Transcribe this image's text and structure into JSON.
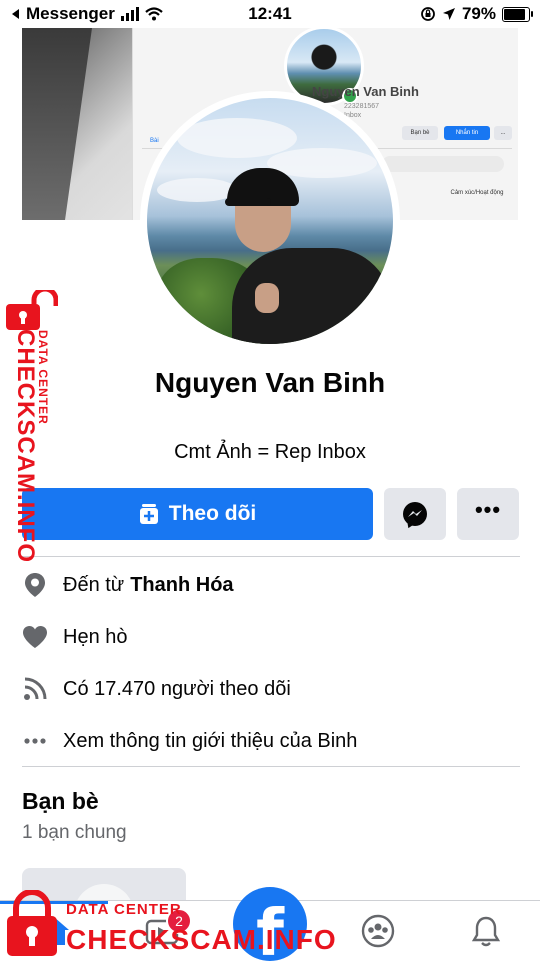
{
  "status_bar": {
    "back_app": "Messenger",
    "time": "12:41",
    "battery": "79%",
    "battery_level": 0.79
  },
  "cover_photo": {
    "name": "Nguyen Van Binh",
    "sub1": "223281567",
    "sub2": "Inbox",
    "btn_friends": "Bạn bè",
    "btn_message": "Nhắn tin",
    "btn_more": "...",
    "tab": "Bài",
    "post_hint": "Cảm xúc/Hoạt động",
    "status_dot_color": "#31a24c"
  },
  "profile": {
    "name": "Nguyen Van Binh",
    "bio": "Cmt Ảnh = Rep Inbox"
  },
  "actions": {
    "follow_label": "Theo dõi",
    "messenger_icon": "messenger-icon",
    "more_label": "•••",
    "accent": "#1877f2"
  },
  "intro": [
    {
      "icon": "location-pin-icon",
      "prefix": "Đến từ",
      "value": "Thanh Hóa"
    },
    {
      "icon": "heart-icon",
      "prefix": "Hẹn hò",
      "value": ""
    },
    {
      "icon": "rss-feed-icon",
      "prefix": "Có 17.470 người theo dõi",
      "value": ""
    },
    {
      "icon": "ellipsis-icon",
      "prefix": "Xem thông tin giới thiệu của Binh",
      "value": ""
    }
  ],
  "friends": {
    "title": "Bạn bè",
    "subtitle": "1 bạn chung"
  },
  "bottom_nav": {
    "video_badge": "2",
    "logo_letter": "f"
  },
  "watermark": {
    "small": "DATA CENTER",
    "big": "CHECKSCAM.INFO"
  }
}
